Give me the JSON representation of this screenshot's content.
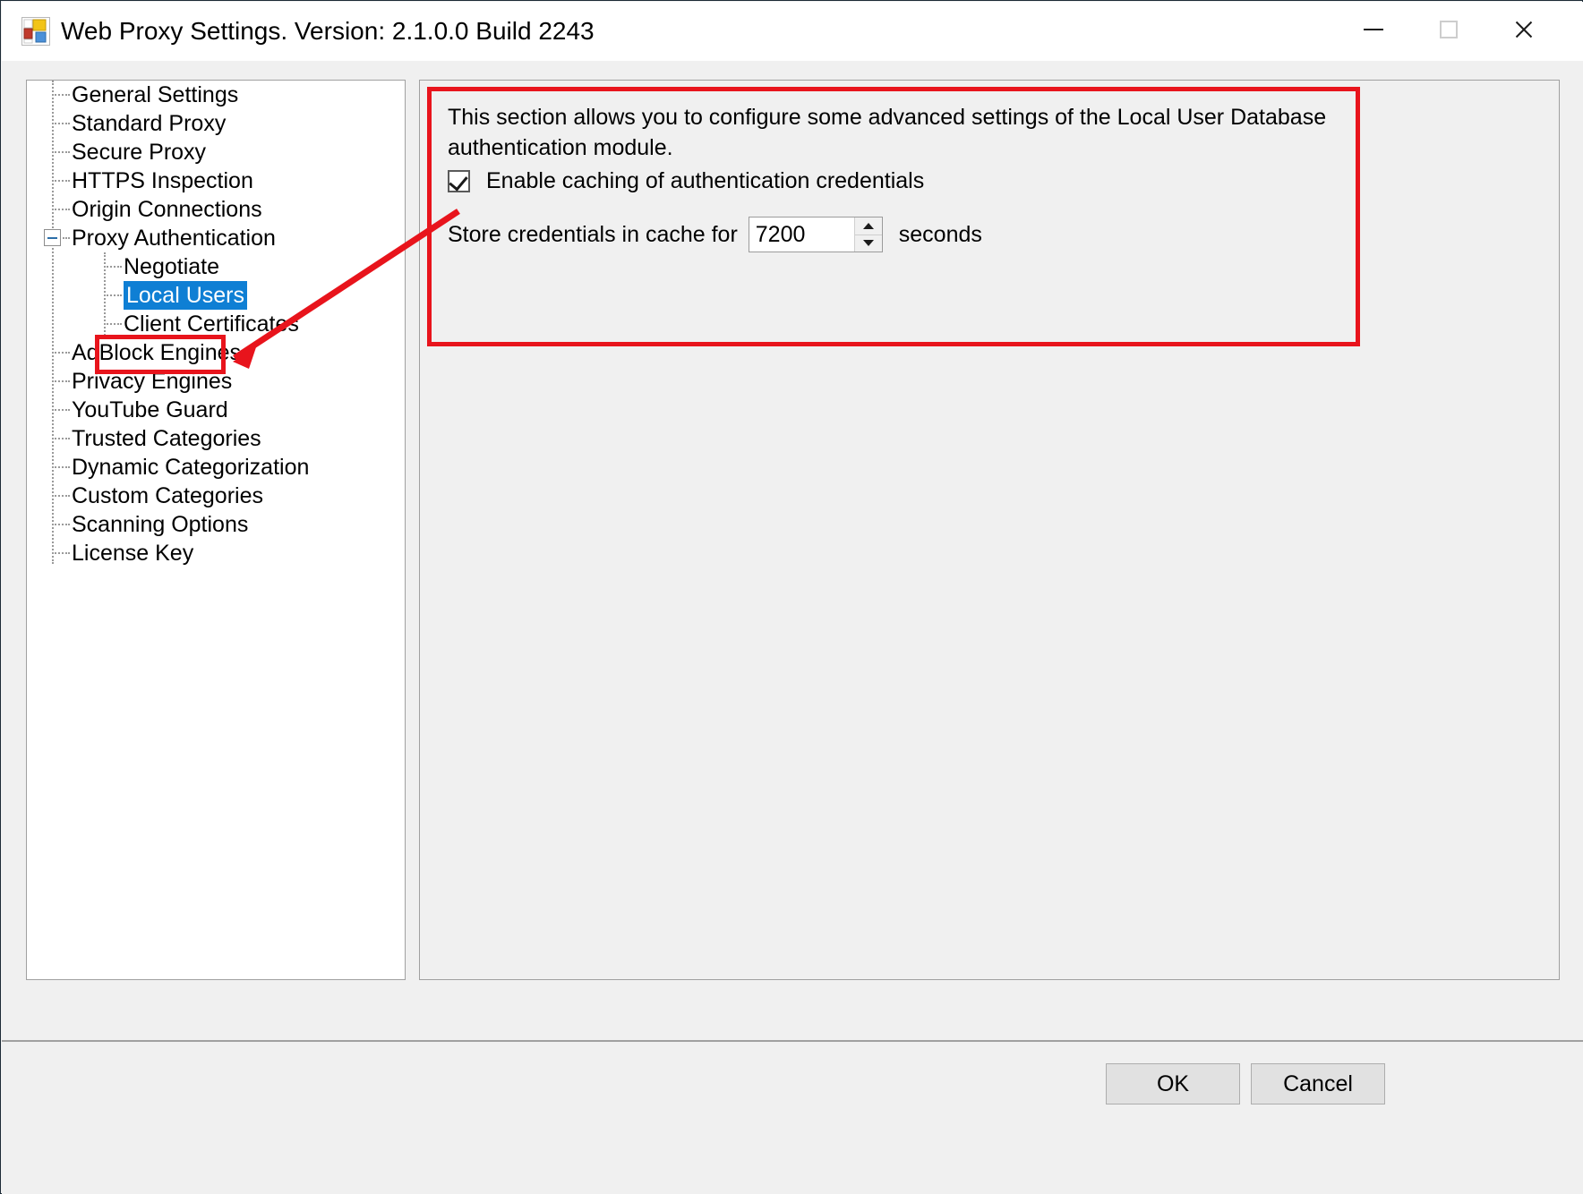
{
  "window": {
    "title": "Web Proxy Settings. Version: 2.1.0.0 Build 2243",
    "icon": "app-tiles-icon",
    "controls": {
      "minimize": "minimize-icon",
      "maximize": "maximize-icon",
      "close": "close-icon"
    }
  },
  "tree": {
    "selected": "Local Users",
    "items": [
      {
        "label": "General Settings",
        "level": 0,
        "expander": null
      },
      {
        "label": "Standard Proxy",
        "level": 0,
        "expander": null
      },
      {
        "label": "Secure Proxy",
        "level": 0,
        "expander": null
      },
      {
        "label": "HTTPS Inspection",
        "level": 0,
        "expander": null
      },
      {
        "label": "Origin Connections",
        "level": 0,
        "expander": null
      },
      {
        "label": "Proxy Authentication",
        "level": 0,
        "expander": "minus"
      },
      {
        "label": "Negotiate",
        "level": 1,
        "expander": null
      },
      {
        "label": "Local Users",
        "level": 1,
        "expander": null
      },
      {
        "label": "Client Certificates",
        "level": 1,
        "expander": null
      },
      {
        "label": "AdBlock Engines",
        "level": 0,
        "expander": null
      },
      {
        "label": "Privacy Engines",
        "level": 0,
        "expander": null
      },
      {
        "label": "YouTube Guard",
        "level": 0,
        "expander": null
      },
      {
        "label": "Trusted Categories",
        "level": 0,
        "expander": null
      },
      {
        "label": "Dynamic Categorization",
        "level": 0,
        "expander": null
      },
      {
        "label": "Custom Categories",
        "level": 0,
        "expander": null
      },
      {
        "label": "Scanning Options",
        "level": 0,
        "expander": null
      },
      {
        "label": "License Key",
        "level": 0,
        "expander": null
      }
    ]
  },
  "content": {
    "description": "This section allows you to configure some advanced settings of the Local User Database authentication module.",
    "enable_caching_label": "Enable caching of authentication credentials",
    "enable_caching_checked": true,
    "store_credentials_prefix": "Store credentials in cache for",
    "store_credentials_value": "7200",
    "store_credentials_suffix": "seconds"
  },
  "annotation": {
    "color": "#e8141c",
    "target": "Local Users"
  },
  "footer": {
    "ok_label": "OK",
    "cancel_label": "Cancel"
  }
}
